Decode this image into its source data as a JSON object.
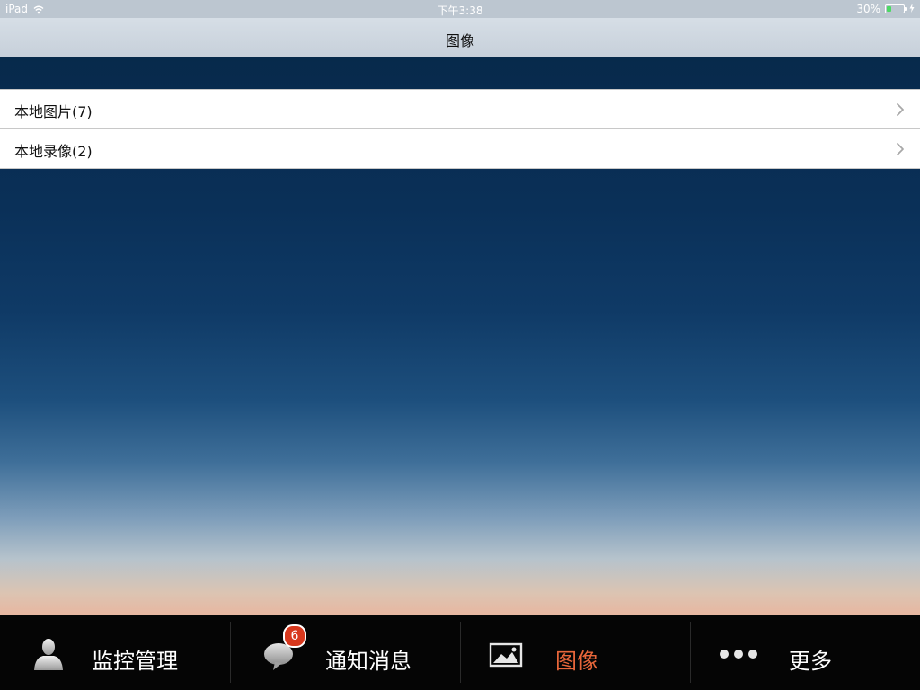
{
  "status_bar": {
    "device": "iPad",
    "time": "下午3:38",
    "battery_percent_text": "30%",
    "battery_level": 0.3
  },
  "nav": {
    "title": "图像"
  },
  "list": {
    "items": [
      {
        "label": "本地图片(7)"
      },
      {
        "label": "本地录像(2)"
      }
    ]
  },
  "tab_bar": {
    "tabs": [
      {
        "label": "监控管理",
        "icon": "person-icon",
        "active": false
      },
      {
        "label": "通知消息",
        "icon": "chat-bubble-icon",
        "active": false,
        "badge": "6"
      },
      {
        "label": "图像",
        "icon": "image-icon",
        "active": true
      },
      {
        "label": "更多",
        "icon": "more-dots-icon",
        "active": false
      }
    ]
  },
  "colors": {
    "active_tab": "#e8663a",
    "badge": "#d8381d",
    "tab_bar_bg": "#050505"
  }
}
